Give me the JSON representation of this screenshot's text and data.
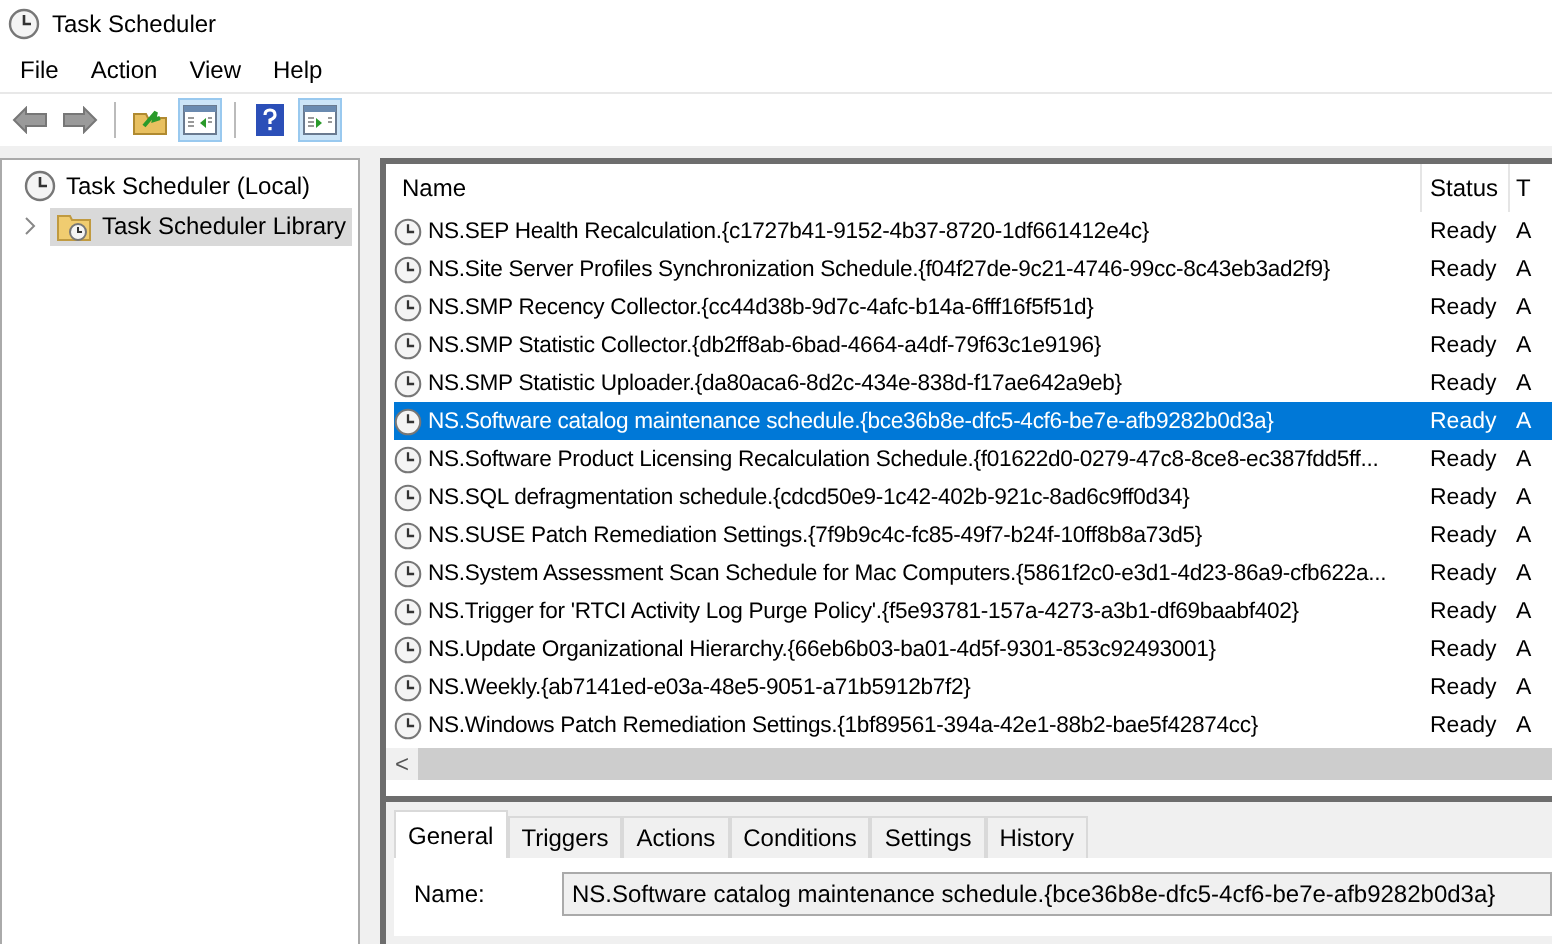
{
  "window": {
    "title": "Task Scheduler"
  },
  "menu": [
    "File",
    "Action",
    "View",
    "Help"
  ],
  "toolbar": [
    {
      "kind": "back",
      "on": false
    },
    {
      "kind": "forward",
      "on": false
    },
    {
      "kind": "sep"
    },
    {
      "kind": "up",
      "on": false
    },
    {
      "kind": "pane-left",
      "on": true
    },
    {
      "kind": "sep"
    },
    {
      "kind": "help",
      "on": false
    },
    {
      "kind": "pane-right",
      "on": true
    }
  ],
  "tree": [
    {
      "label": "Task Scheduler (Local)",
      "selected": false,
      "children": [
        {
          "label": "Task Scheduler Library",
          "selected": true,
          "expanded": false
        }
      ]
    }
  ],
  "table": {
    "columns": [
      "Name",
      "Status",
      "T"
    ],
    "rows": [
      {
        "name": "NS.SEP Health Recalculation.{c1727b41-9152-4b37-8720-1df661412e4c}",
        "status": "Ready",
        "column_3": "A",
        "selected": false
      },
      {
        "name": "NS.Site Server Profiles Synchronization Schedule.{f04f27de-9c21-4746-99cc-8c43eb3ad2f9}",
        "status": "Ready",
        "column_3": "A",
        "selected": false
      },
      {
        "name": "NS.SMP Recency Collector.{cc44d38b-9d7c-4afc-b14a-6fff16f5f51d}",
        "status": "Ready",
        "column_3": "A",
        "selected": false
      },
      {
        "name": "NS.SMP Statistic Collector.{db2ff8ab-6bad-4664-a4df-79f63c1e9196}",
        "status": "Ready",
        "column_3": "A",
        "selected": false
      },
      {
        "name": "NS.SMP Statistic Uploader.{da80aca6-8d2c-434e-838d-f17ae642a9eb}",
        "status": "Ready",
        "column_3": "A",
        "selected": false
      },
      {
        "name": "NS.Software catalog maintenance schedule.{bce36b8e-dfc5-4cf6-be7e-afb9282b0d3a}",
        "status": "Ready",
        "column_3": "A",
        "selected": true
      },
      {
        "name": "NS.Software Product Licensing Recalculation Schedule.{f01622d0-0279-47c8-8ce8-ec387fdd5ff...",
        "status": "Ready",
        "column_3": "A",
        "selected": false
      },
      {
        "name": "NS.SQL defragmentation schedule.{cdcd50e9-1c42-402b-921c-8ad6c9ff0d34}",
        "status": "Ready",
        "column_3": "A",
        "selected": false
      },
      {
        "name": "NS.SUSE Patch Remediation Settings.{7f9b9c4c-fc85-49f7-b24f-10ff8b8a73d5}",
        "status": "Ready",
        "column_3": "A",
        "selected": false
      },
      {
        "name": "NS.System Assessment Scan Schedule for Mac Computers.{5861f2c0-e3d1-4d23-86a9-cfb622a...",
        "status": "Ready",
        "column_3": "A",
        "selected": false
      },
      {
        "name": "NS.Trigger for 'RTCI Activity Log Purge Policy'.{f5e93781-157a-4273-a3b1-df69baabf402}",
        "status": "Ready",
        "column_3": "A",
        "selected": false
      },
      {
        "name": "NS.Update Organizational Hierarchy.{66eb6b03-ba01-4d5f-9301-853c92493001}",
        "status": "Ready",
        "column_3": "A",
        "selected": false
      },
      {
        "name": "NS.Weekly.{ab7141ed-e03a-48e5-9051-a71b5912b7f2}",
        "status": "Ready",
        "column_3": "A",
        "selected": false
      },
      {
        "name": "NS.Windows Patch Remediation Settings.{1bf89561-394a-42e1-88b2-bae5f42874cc}",
        "status": "Ready",
        "column_3": "A",
        "selected": false
      }
    ]
  },
  "scrollbar_arrow": "<",
  "tabs": [
    {
      "label": "General",
      "selected": true
    },
    {
      "label": "Triggers",
      "selected": false
    },
    {
      "label": "Actions",
      "selected": false
    },
    {
      "label": "Conditions",
      "selected": false
    },
    {
      "label": "Settings",
      "selected": false
    },
    {
      "label": "History",
      "selected": false
    }
  ],
  "general": {
    "name_label": "Name:",
    "name_value": "NS.Software catalog maintenance schedule.{bce36b8e-dfc5-4cf6-be7e-afb9282b0d3a}"
  }
}
